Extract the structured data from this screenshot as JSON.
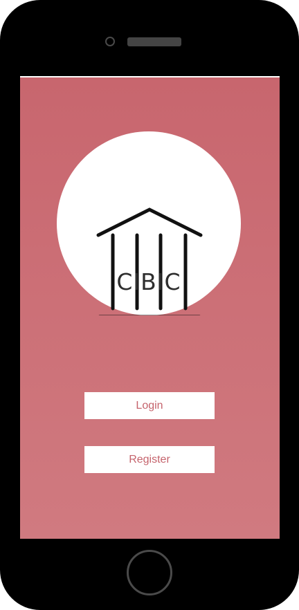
{
  "app": {
    "logo_text": "CIBIC",
    "logo_icon": "bank-columns-icon"
  },
  "buttons": {
    "login_label": "Login",
    "register_label": "Register"
  },
  "colors": {
    "device": "#000000",
    "screen_gradient_top": "#c8666e",
    "screen_gradient_bottom": "#d07a80",
    "button_background": "#ffffff",
    "button_text": "#c5636c",
    "logo_text": "#2e2e2e"
  }
}
